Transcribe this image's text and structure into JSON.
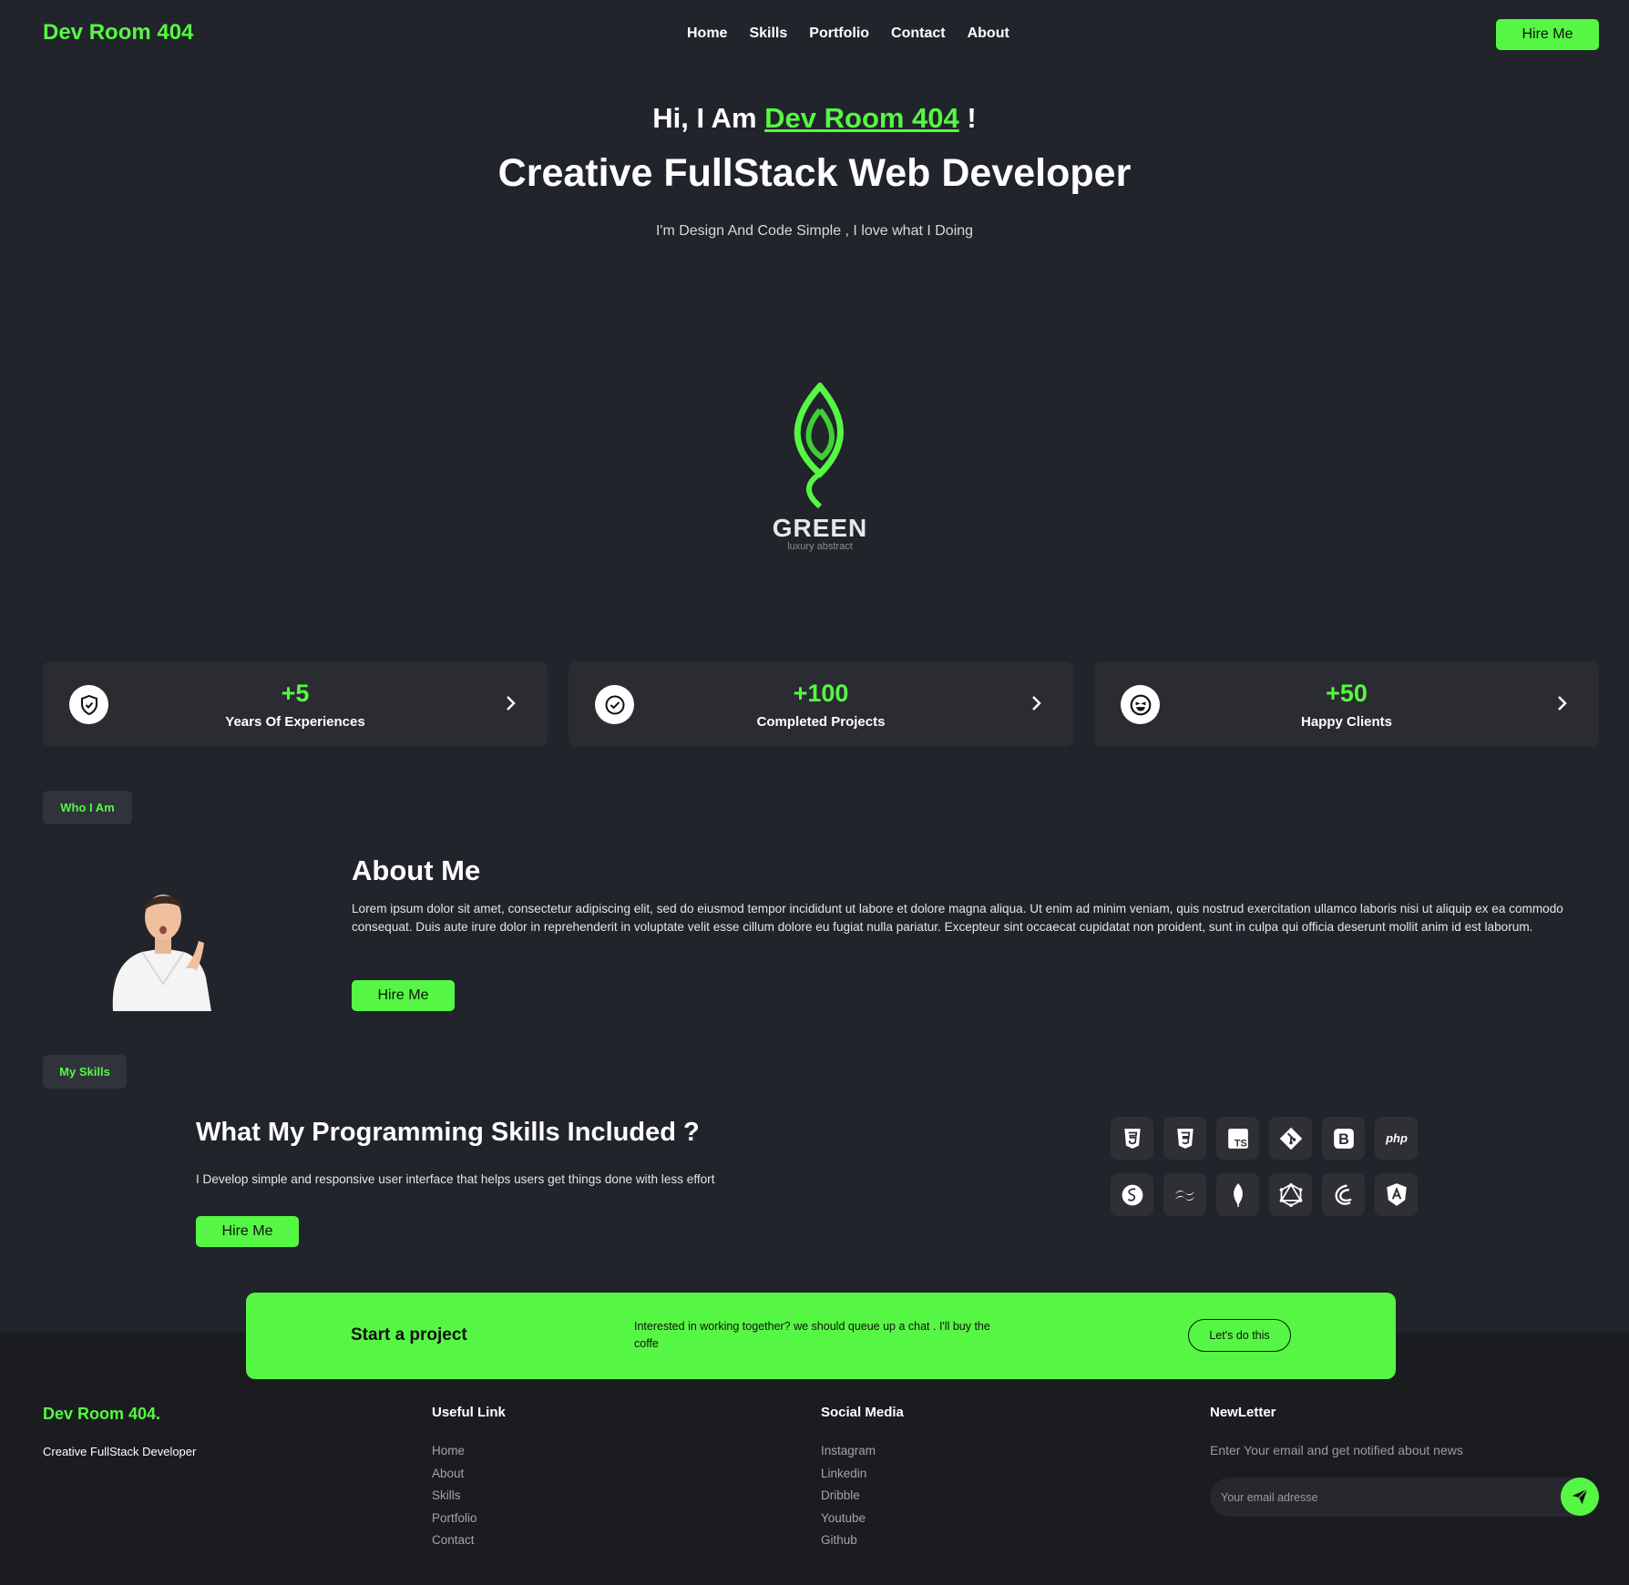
{
  "nav": {
    "logo": "Dev Room 404",
    "links": [
      "Home",
      "Skills",
      "Portfolio",
      "Contact",
      "About"
    ],
    "hire_label": "Hire Me"
  },
  "hero": {
    "greeting_prefix": "Hi, I Am",
    "greeting_name": "Dev Room 404",
    "greeting_suffix": "!",
    "title": "Creative FullStack Web Developer",
    "subtitle": "I'm Design And Code Simple , I love what I Doing"
  },
  "brand_logo": {
    "name": "GREEN",
    "tagline": "luxury abstract",
    "color": "#56f744"
  },
  "stats": [
    {
      "value": "+5",
      "label": "Years Of Experiences",
      "icon": "shield-check-icon"
    },
    {
      "value": "+100",
      "label": "Completed Projects",
      "icon": "check-circle-icon"
    },
    {
      "value": "+50",
      "label": "Happy Clients",
      "icon": "happy-face-icon"
    }
  ],
  "about": {
    "tag": "Who I Am",
    "title": "About Me",
    "text": "Lorem ipsum dolor sit amet, consectetur adipiscing elit, sed do eiusmod tempor incididunt ut labore et dolore magna aliqua. Ut enim ad minim veniam, quis nostrud exercitation ullamco laboris nisi ut aliquip ex ea commodo consequat. Duis aute irure dolor in reprehenderit in voluptate velit esse cillum dolore eu fugiat nulla pariatur. Excepteur sint occaecat cupidatat non proident, sunt in culpa qui officia deserunt mollit anim id est laborum.",
    "hire_label": "Hire Me"
  },
  "skills": {
    "tag": "My Skills",
    "title": "What My Programming Skills Included ?",
    "text": "I Develop simple and responsive user interface that helps users get things done with less effort",
    "hire_label": "Hire Me",
    "icons": [
      {
        "name": "html5-icon",
        "glyph": "5"
      },
      {
        "name": "css3-icon",
        "glyph": "3"
      },
      {
        "name": "typescript-icon",
        "glyph": "TS"
      },
      {
        "name": "git-icon",
        "glyph": "◆"
      },
      {
        "name": "bootstrap-icon",
        "glyph": "B"
      },
      {
        "name": "php-icon",
        "glyph": "php"
      },
      {
        "name": "sass-icon",
        "glyph": "S"
      },
      {
        "name": "tailwind-icon",
        "glyph": "~"
      },
      {
        "name": "mongodb-icon",
        "glyph": "●"
      },
      {
        "name": "graphql-icon",
        "glyph": "⬡"
      },
      {
        "name": "redux-saga-icon",
        "glyph": "☾"
      },
      {
        "name": "angular-icon",
        "glyph": "A"
      }
    ]
  },
  "cta": {
    "title": "Start a project",
    "text": "Interested in working together? we should queue up a chat . I'll buy the coffe",
    "button": "Let's do this"
  },
  "footer": {
    "brand": "Dev Room 404.",
    "tagline": "Creative FullStack Developer",
    "useful_title": "Useful Link",
    "useful_links": [
      "Home",
      "About",
      "Skills",
      "Portfolio",
      "Contact"
    ],
    "social_title": "Social Media",
    "social_links": [
      "Instagram",
      "Linkedin",
      "Dribble",
      "Youtube",
      "Github"
    ],
    "newsletter_title": "NewLetter",
    "newsletter_text": "Enter Your email and get notified about news",
    "newsletter_placeholder": "Your email adresse"
  },
  "colors": {
    "accent": "#56f744",
    "background": "#21242a",
    "footer": "#1b1c1f",
    "card": "#2a2c31"
  }
}
